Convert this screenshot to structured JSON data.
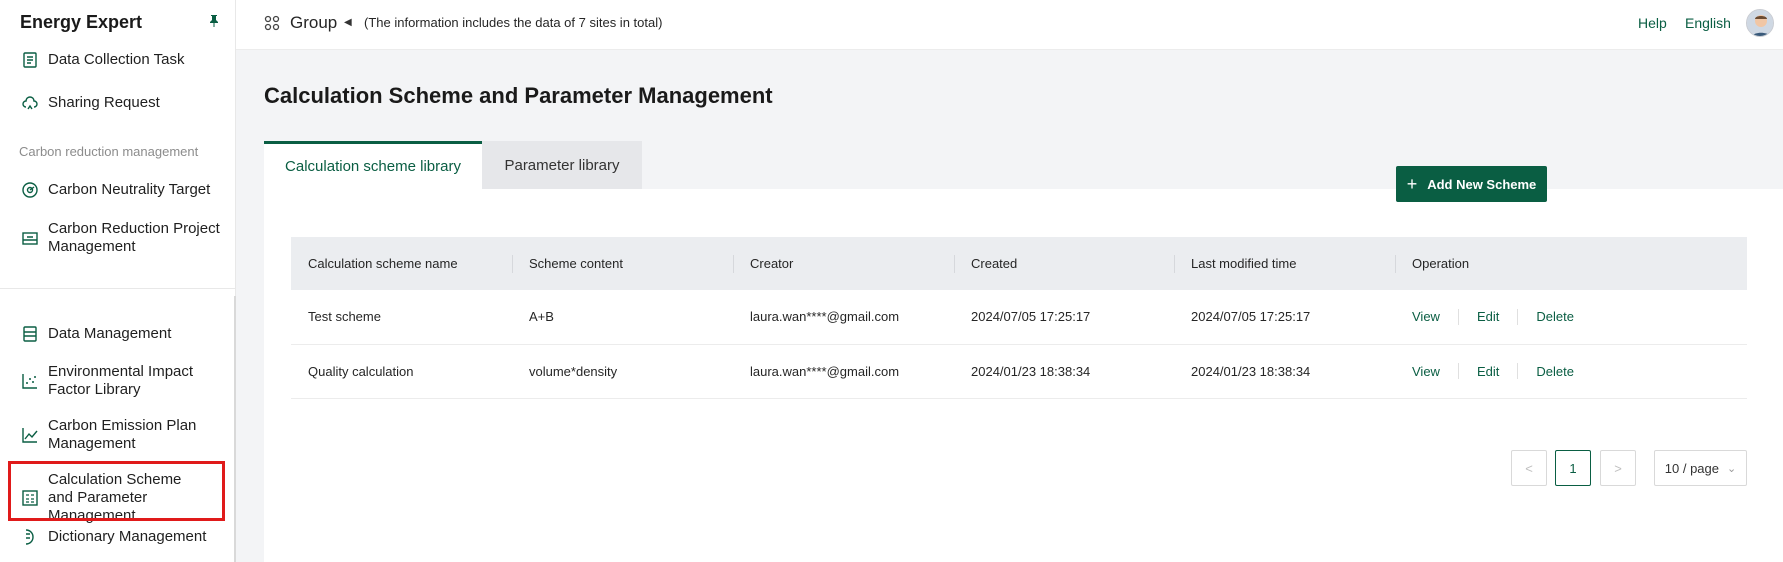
{
  "sidebar": {
    "brand": "Energy Expert",
    "pin_icon": "pin-icon",
    "items_top": [
      {
        "label": "Data Collection Task",
        "icon": "task-list-icon"
      },
      {
        "label": "Sharing Request",
        "icon": "cloud-share-icon"
      }
    ],
    "section_label": "Carbon reduction management",
    "items_carbon": [
      {
        "label": "Carbon Neutrality Target",
        "icon": "gauge-icon"
      },
      {
        "label": "Carbon Reduction Project Management",
        "icon": "project-board-icon"
      }
    ],
    "items_bottom": [
      {
        "label": "Data Management",
        "icon": "database-icon"
      },
      {
        "label": "Environmental Impact Factor Library",
        "icon": "scatter-icon"
      },
      {
        "label": "Carbon Emission Plan Management",
        "icon": "line-chart-icon"
      },
      {
        "label": "Calculation Scheme and Parameter Management",
        "icon": "calculator-icon",
        "selected": true
      },
      {
        "label": "Dictionary Management",
        "icon": "dictionary-icon"
      }
    ]
  },
  "topbar": {
    "group_label": "Group",
    "info": "(The information includes the data of 7 sites in total)",
    "help": "Help",
    "language": "English"
  },
  "main": {
    "title": "Calculation Scheme and Parameter Management",
    "tabs": [
      {
        "label": "Calculation scheme library",
        "active": true
      },
      {
        "label": "Parameter library",
        "active": false
      }
    ],
    "add_button": "Add New Scheme",
    "table": {
      "columns": [
        "Calculation scheme name",
        "Scheme content",
        "Creator",
        "Created",
        "Last modified time",
        "Operation"
      ],
      "rows": [
        {
          "name": "Test scheme",
          "content": "A+B",
          "creator": "laura.wan****@gmail.com",
          "created": "2024/07/05 17:25:17",
          "modified": "2024/07/05 17:25:17"
        },
        {
          "name": "Quality calculation",
          "content": "volume*density",
          "creator": "laura.wan****@gmail.com",
          "created": "2024/01/23 18:38:34",
          "modified": "2024/01/23 18:38:34"
        }
      ],
      "operations": {
        "view": "View",
        "edit": "Edit",
        "delete": "Delete"
      }
    },
    "pagination": {
      "prev": "<",
      "current": "1",
      "next": ">",
      "page_size": "10 / page"
    }
  },
  "colors": {
    "accent": "#0a5e43",
    "highlight_box": "#e01a1a",
    "background": "#f3f4f6"
  }
}
